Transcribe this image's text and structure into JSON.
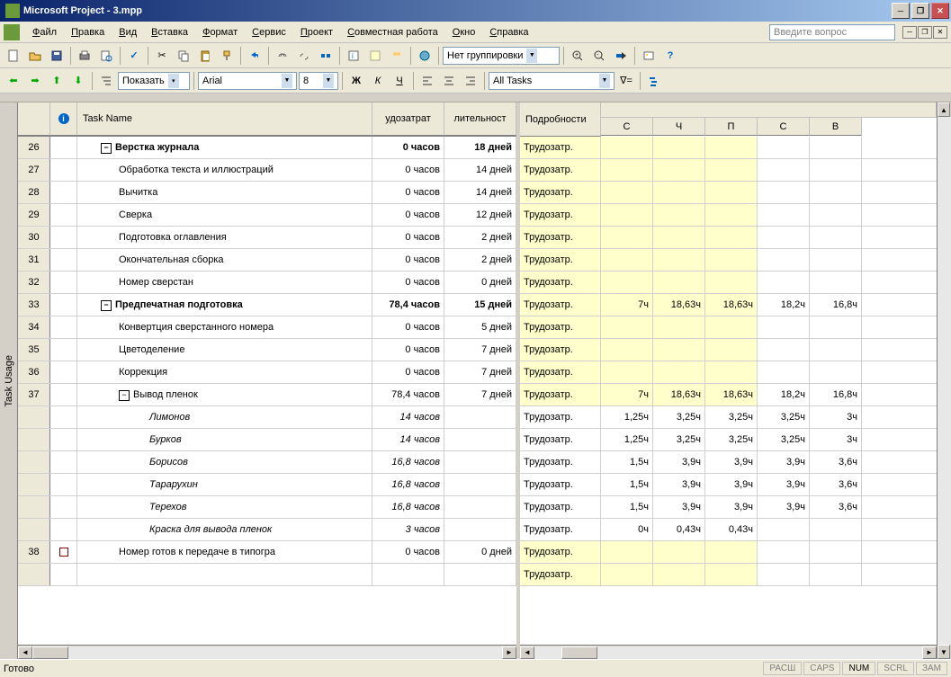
{
  "window": {
    "title": "Microsoft Project - 3.mpp"
  },
  "menu": [
    "Файл",
    "Правка",
    "Вид",
    "Вставка",
    "Формат",
    "Сервис",
    "Проект",
    "Совместная работа",
    "Окно",
    "Справка"
  ],
  "help_placeholder": "Введите вопрос",
  "toolbar2": {
    "show_label": "Показать",
    "font": "Arial",
    "font_size": "8",
    "filter": "All Tasks",
    "group": "Нет группировки"
  },
  "sidebar": {
    "label": "Task Usage"
  },
  "columns": {
    "taskname": "Task Name",
    "work": "удозатрат",
    "duration": "лительност"
  },
  "right": {
    "details": "Подробности",
    "days": [
      "С",
      "Ч",
      "П",
      "С",
      "В"
    ],
    "detail_label": "Трудозатр."
  },
  "rows": [
    {
      "n": "26",
      "name": "Верстка журнала",
      "w": "0 часов",
      "d": "18 дней",
      "bold": true,
      "cls": "indent1",
      "outline": true,
      "yellow": true,
      "vals": [
        "",
        "",
        "",
        "",
        ""
      ]
    },
    {
      "n": "27",
      "name": "Обработка текста и иллюстраций",
      "w": "0 часов",
      "d": "14 дней",
      "cls": "indent2",
      "yellow": true,
      "vals": [
        "",
        "",
        "",
        "",
        ""
      ]
    },
    {
      "n": "28",
      "name": "Вычитка",
      "w": "0 часов",
      "d": "14 дней",
      "cls": "indent2",
      "yellow": true,
      "vals": [
        "",
        "",
        "",
        "",
        ""
      ]
    },
    {
      "n": "29",
      "name": "Сверка",
      "w": "0 часов",
      "d": "12 дней",
      "cls": "indent2",
      "yellow": true,
      "vals": [
        "",
        "",
        "",
        "",
        ""
      ]
    },
    {
      "n": "30",
      "name": "Подготовка оглавления",
      "w": "0 часов",
      "d": "2 дней",
      "cls": "indent2",
      "yellow": true,
      "vals": [
        "",
        "",
        "",
        "",
        ""
      ]
    },
    {
      "n": "31",
      "name": "Окончательная сборка",
      "w": "0 часов",
      "d": "2 дней",
      "cls": "indent2",
      "yellow": true,
      "vals": [
        "",
        "",
        "",
        "",
        ""
      ]
    },
    {
      "n": "32",
      "name": "Номер сверстан",
      "w": "0 часов",
      "d": "0 дней",
      "cls": "indent2",
      "yellow": true,
      "vals": [
        "",
        "",
        "",
        "",
        ""
      ]
    },
    {
      "n": "33",
      "name": "Предпечатная подготовка",
      "w": "78,4 часов",
      "d": "15 дней",
      "bold": true,
      "cls": "indent1",
      "outline": true,
      "yellow": true,
      "vals": [
        "7ч",
        "18,63ч",
        "18,63ч",
        "18,2ч",
        "16,8ч"
      ]
    },
    {
      "n": "34",
      "name": "Конвертция сверстанного номера",
      "w": "0 часов",
      "d": "5 дней",
      "cls": "indent2",
      "yellow": true,
      "vals": [
        "",
        "",
        "",
        "",
        ""
      ]
    },
    {
      "n": "35",
      "name": "Цветоделение",
      "w": "0 часов",
      "d": "7 дней",
      "cls": "indent2",
      "yellow": true,
      "vals": [
        "",
        "",
        "",
        "",
        ""
      ]
    },
    {
      "n": "36",
      "name": "Коррекция",
      "w": "0 часов",
      "d": "7 дней",
      "cls": "indent2",
      "yellow": true,
      "vals": [
        "",
        "",
        "",
        "",
        ""
      ]
    },
    {
      "n": "37",
      "name": "Вывод пленок",
      "w": "78,4 часов",
      "d": "7 дней",
      "cls": "indent2",
      "outline": true,
      "yellow": true,
      "vals": [
        "7ч",
        "18,63ч",
        "18,63ч",
        "18,2ч",
        "16,8ч"
      ]
    },
    {
      "n": "",
      "name": "Лимонов",
      "w": "14 часов",
      "d": "",
      "italic": true,
      "cls": "indent4",
      "vals": [
        "1,25ч",
        "3,25ч",
        "3,25ч",
        "3,25ч",
        "3ч"
      ]
    },
    {
      "n": "",
      "name": "Бурков",
      "w": "14 часов",
      "d": "",
      "italic": true,
      "cls": "indent4",
      "vals": [
        "1,25ч",
        "3,25ч",
        "3,25ч",
        "3,25ч",
        "3ч"
      ]
    },
    {
      "n": "",
      "name": "Борисов",
      "w": "16,8 часов",
      "d": "",
      "italic": true,
      "cls": "indent4",
      "vals": [
        "1,5ч",
        "3,9ч",
        "3,9ч",
        "3,9ч",
        "3,6ч"
      ]
    },
    {
      "n": "",
      "name": "Тарарухин",
      "w": "16,8 часов",
      "d": "",
      "italic": true,
      "cls": "indent4",
      "vals": [
        "1,5ч",
        "3,9ч",
        "3,9ч",
        "3,9ч",
        "3,6ч"
      ]
    },
    {
      "n": "",
      "name": "Терехов",
      "w": "16,8 часов",
      "d": "",
      "italic": true,
      "cls": "indent4",
      "vals": [
        "1,5ч",
        "3,9ч",
        "3,9ч",
        "3,9ч",
        "3,6ч"
      ]
    },
    {
      "n": "",
      "name": "Краска для вывода пленок",
      "w": "3 часов",
      "d": "",
      "italic": true,
      "cls": "indent4",
      "vals": [
        "0ч",
        "0,43ч",
        "0,43ч",
        "",
        ""
      ]
    },
    {
      "n": "38",
      "name": "Номер готов к передаче в типогра",
      "w": "0 часов",
      "d": "0 дней",
      "cls": "indent2",
      "ind": "milestone",
      "yellow": true,
      "vals": [
        "",
        "",
        "",
        "",
        ""
      ]
    },
    {
      "n": "",
      "name": "",
      "w": "",
      "d": "",
      "yellow": true,
      "vals": [
        "",
        "",
        "",
        "",
        ""
      ]
    }
  ],
  "status": {
    "ready": "Готово",
    "indicators": [
      "РАСШ",
      "CAPS",
      "NUM",
      "SCRL",
      "ЗАМ"
    ],
    "on": 2
  }
}
